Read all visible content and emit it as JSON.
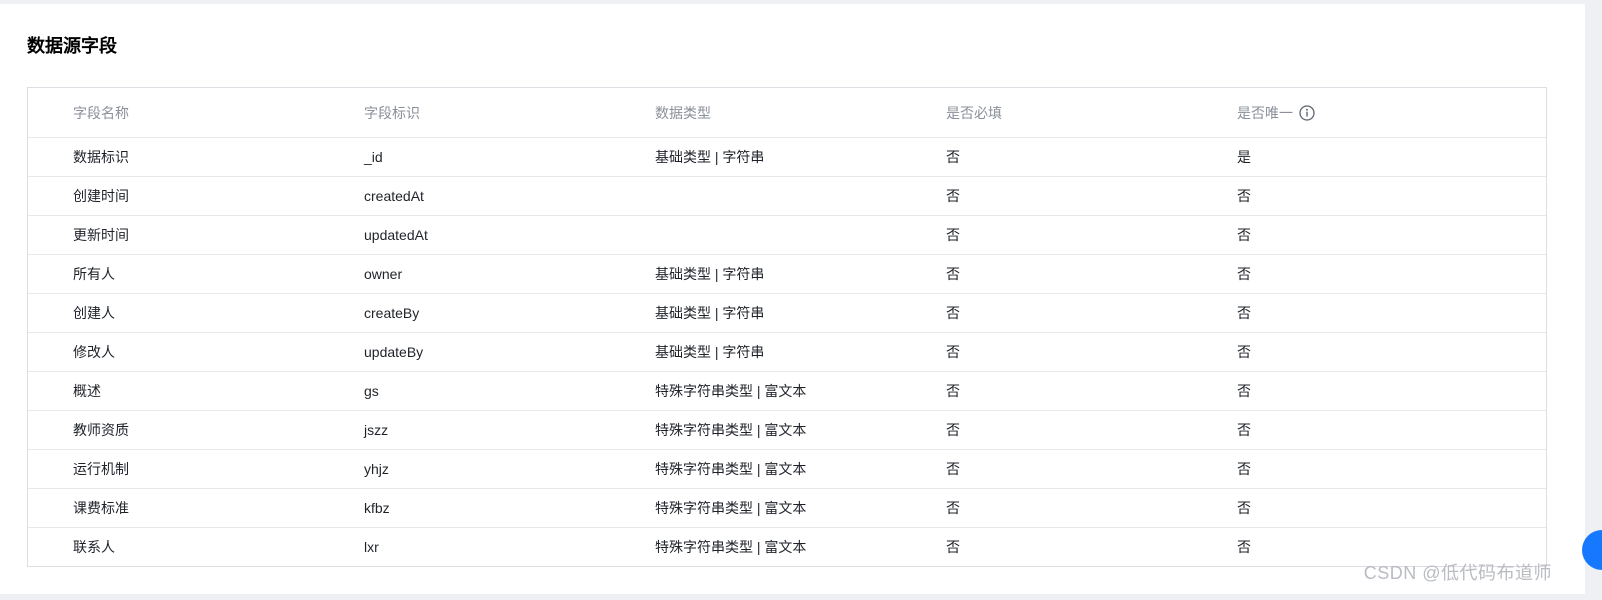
{
  "section": {
    "title": "数据源字段"
  },
  "table": {
    "headers": {
      "name": "字段名称",
      "id": "字段标识",
      "type": "数据类型",
      "required": "是否必填",
      "unique": "是否唯一"
    },
    "rows": [
      {
        "name": "数据标识",
        "id": "_id",
        "type": "基础类型 | 字符串",
        "required": "否",
        "unique": "是"
      },
      {
        "name": "创建时间",
        "id": "createdAt",
        "type": "",
        "required": "否",
        "unique": "否"
      },
      {
        "name": "更新时间",
        "id": "updatedAt",
        "type": "",
        "required": "否",
        "unique": "否"
      },
      {
        "name": "所有人",
        "id": "owner",
        "type": "基础类型 | 字符串",
        "required": "否",
        "unique": "否"
      },
      {
        "name": "创建人",
        "id": "createBy",
        "type": "基础类型 | 字符串",
        "required": "否",
        "unique": "否"
      },
      {
        "name": "修改人",
        "id": "updateBy",
        "type": "基础类型 | 字符串",
        "required": "否",
        "unique": "否"
      },
      {
        "name": "概述",
        "id": "gs",
        "type": "特殊字符串类型 | 富文本",
        "required": "否",
        "unique": "否"
      },
      {
        "name": "教师资质",
        "id": "jszz",
        "type": "特殊字符串类型 | 富文本",
        "required": "否",
        "unique": "否"
      },
      {
        "name": "运行机制",
        "id": "yhjz",
        "type": "特殊字符串类型 | 富文本",
        "required": "否",
        "unique": "否"
      },
      {
        "name": "课费标准",
        "id": "kfbz",
        "type": "特殊字符串类型 | 富文本",
        "required": "否",
        "unique": "否"
      },
      {
        "name": "联系人",
        "id": "lxr",
        "type": "特殊字符串类型 | 富文本",
        "required": "否",
        "unique": "否"
      }
    ]
  },
  "icons": {
    "unique_info": "info-circle-icon"
  },
  "colors": {
    "accent": "#1677ff",
    "header_text": "#8a8f99",
    "border": "#dcdee3"
  },
  "watermark": "CSDN @低代码布道师"
}
